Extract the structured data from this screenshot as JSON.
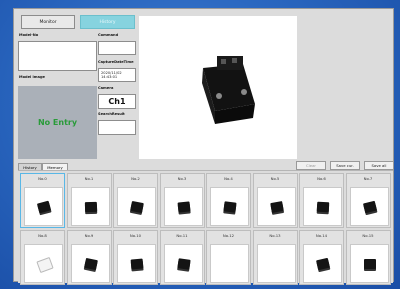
{
  "toolbar": {
    "monitor_label": "Monitor",
    "history_label": "History"
  },
  "left_panel": {
    "model_no_label": "Model-No",
    "model_no_value": "",
    "model_image_label": "Model image",
    "model_image_status": "No Entry"
  },
  "fields": {
    "command_label": "Command",
    "command_value": "",
    "capture_label": "CaptureDateTime",
    "capture_value": "2020/11/02 14:43:01",
    "camera_label": "Camera",
    "camera_value": "Ch1",
    "search_label": "SearchResult",
    "search_value": ""
  },
  "tabs": [
    {
      "label": "History"
    },
    {
      "label": "Memory"
    }
  ],
  "actions": {
    "clear_label": "Clear",
    "save_current_label": "Save cur.",
    "save_all_label": "Save all"
  },
  "slots": [
    {
      "label": "No.0",
      "content": "part",
      "selected": true
    },
    {
      "label": "No.1",
      "content": "part"
    },
    {
      "label": "No.2",
      "content": "part"
    },
    {
      "label": "No.3",
      "content": "part"
    },
    {
      "label": "No.4",
      "content": "part"
    },
    {
      "label": "No.5",
      "content": "part"
    },
    {
      "label": "No.6",
      "content": "part"
    },
    {
      "label": "No.7",
      "content": "part"
    },
    {
      "label": "No.8",
      "content": "part-light"
    },
    {
      "label": "No.9",
      "content": "part"
    },
    {
      "label": "No.10",
      "content": "part"
    },
    {
      "label": "No.11",
      "content": "part"
    },
    {
      "label": "No.12",
      "content": "empty"
    },
    {
      "label": "No.13",
      "content": "empty"
    },
    {
      "label": "No.14",
      "content": "part"
    },
    {
      "label": "No.15",
      "content": "part"
    }
  ],
  "colors": {
    "background": "#2a67c0",
    "window": "#dcdcdc",
    "accent_tab": "#86d3df",
    "no_entry": "#2a9b3a",
    "selected_slot": "#59b7e6"
  }
}
